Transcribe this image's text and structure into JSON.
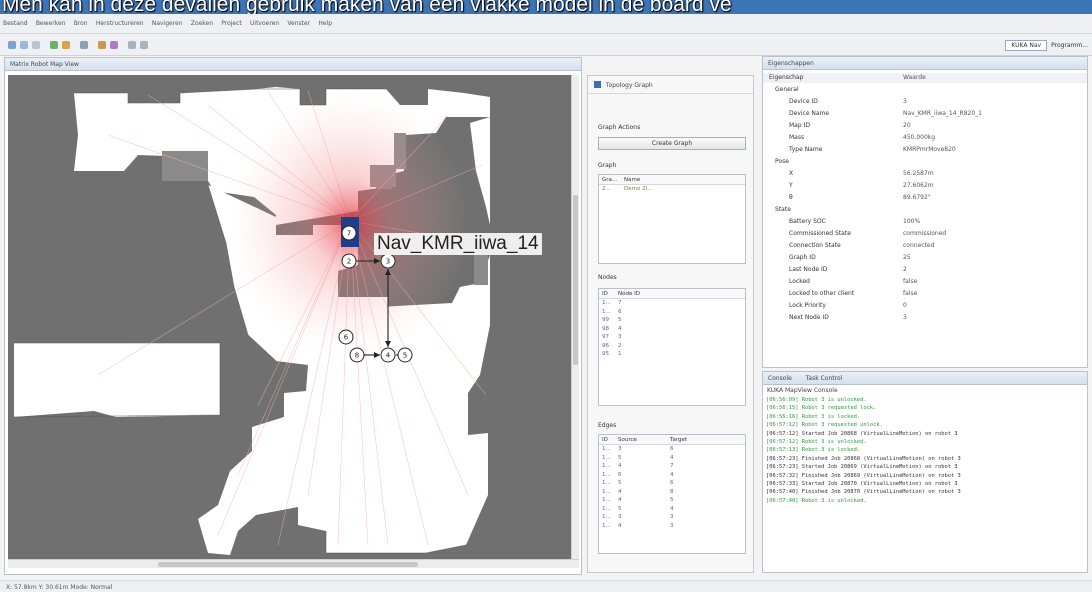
{
  "caption": "Men kan in deze devailen gebruik maken van een vlakke model in de board ve",
  "menu": [
    "Bestand",
    "Bewerken",
    "Bron",
    "Herstructureren",
    "Navigeren",
    "Zoeken",
    "Project",
    "Uitvoeren",
    "Venster",
    "Help"
  ],
  "perspective": {
    "button": "KUKA Nav",
    "label": "Programm..."
  },
  "editor_tab": "Matrix Robot Map View",
  "map": {
    "robot_label": "Nav_KMR_iiwa_14",
    "nodes": [
      "7",
      "2",
      "3",
      "6",
      "8",
      "4",
      "5"
    ]
  },
  "topology": {
    "title": "Topology Graph",
    "graph_actions": "Graph Actions",
    "create_graph": "Create Graph",
    "graph_section": "Graph",
    "graph_cols": [
      "Gra...",
      "Name"
    ],
    "graph_rows": [
      [
        "2...",
        "Demo 2l..."
      ]
    ],
    "nodes_section": "Nodes",
    "nodes_cols": [
      "ID",
      "Node ID"
    ],
    "nodes_rows": [
      [
        "1...",
        "7"
      ],
      [
        "1...",
        "6"
      ],
      [
        "99",
        "5"
      ],
      [
        "98",
        "4"
      ],
      [
        "97",
        "3"
      ],
      [
        "96",
        "2"
      ],
      [
        "95",
        "1"
      ]
    ],
    "edges_section": "Edges",
    "edges_cols": [
      "ID",
      "Source",
      "Target"
    ],
    "edges_rows": [
      [
        "1...",
        "3",
        "6"
      ],
      [
        "1...",
        "5",
        "4"
      ],
      [
        "1...",
        "4",
        "7"
      ],
      [
        "1...",
        "6",
        "4"
      ],
      [
        "1...",
        "5",
        "6"
      ],
      [
        "1...",
        "4",
        "8"
      ],
      [
        "1...",
        "4",
        "5"
      ],
      [
        "1...",
        "5",
        "4"
      ],
      [
        "1...",
        "3",
        "3"
      ],
      [
        "1...",
        "4",
        "3"
      ]
    ]
  },
  "properties": {
    "tab": "Eigenschappen",
    "col_property": "Eigenschap",
    "col_value": "Waarde",
    "sections": [
      {
        "name": "General",
        "rows": [
          [
            "Device ID",
            "3"
          ],
          [
            "Device Name",
            "Nav_KMR_iiwa_14_R820_1"
          ],
          [
            "Map ID",
            "20"
          ],
          [
            "Mass",
            "450.000kg"
          ],
          [
            "Type Name",
            "KMRPmrMove820"
          ]
        ]
      },
      {
        "name": "Pose",
        "rows": [
          [
            "X",
            "56.2587m"
          ],
          [
            "Y",
            "27.6062m"
          ],
          [
            "θ",
            "89.6792°"
          ]
        ]
      },
      {
        "name": "State",
        "rows": [
          [
            "Battery SOC",
            "100%"
          ],
          [
            "Commissioned State",
            "commissioned"
          ],
          [
            "Connection State",
            "connected"
          ],
          [
            "Graph ID",
            "25"
          ],
          [
            "Last Node ID",
            "2"
          ],
          [
            "Locked",
            "false"
          ],
          [
            "Locked to other client",
            "false"
          ],
          [
            "Lock Priority",
            "0"
          ],
          [
            "Next Node ID",
            "3"
          ]
        ]
      }
    ]
  },
  "console": {
    "tab1": "Console",
    "tab2": "Task Control",
    "title": "KUKA MapView Console",
    "lines": [
      {
        "t": "[06:56:09] Robot 3 is unlocked.",
        "c": "green"
      },
      {
        "t": "[06:56:15] Robot 3 requested lock.",
        "c": "green"
      },
      {
        "t": "[06:56:16] Robot 3 is locked.",
        "c": "green"
      },
      {
        "t": "[06:57:12] Robot 3 requested unlock.",
        "c": "green"
      },
      {
        "t": "[06:57:12] Started Job 20868 (VirtualLineMotion) on robot 3",
        "c": "dark"
      },
      {
        "t": "[06:57:12] Robot 3 is unlocked.",
        "c": "green"
      },
      {
        "t": "[06:57:13] Robot 3 is locked.",
        "c": "green"
      },
      {
        "t": "[06:57:23] Finished Job 20868 (VirtualLineMotion) on robot 3",
        "c": "dark"
      },
      {
        "t": "[06:57:23] Started Job 20869 (VirtualLineMotion) on robot 3",
        "c": "dark"
      },
      {
        "t": "[06:57:32] Finished Job 20869 (VirtualLineMotion) on robot 3",
        "c": "dark"
      },
      {
        "t": "[06:57:33] Started Job 20870 (VirtualLineMotion) on robot 3",
        "c": "dark"
      },
      {
        "t": "[06:57:40] Finished Job 20870 (VirtualLineMotion) on robot 3",
        "c": "dark"
      },
      {
        "t": "[06:57:40] Robot 3 is unlocked.",
        "c": "green"
      }
    ]
  },
  "status": "X: 57.8km  Y: 30.61m  Mode: Normal",
  "colors": {
    "console_green": "#2e9a3e",
    "console_dark": "#333333",
    "accent": "#3c74b8"
  }
}
